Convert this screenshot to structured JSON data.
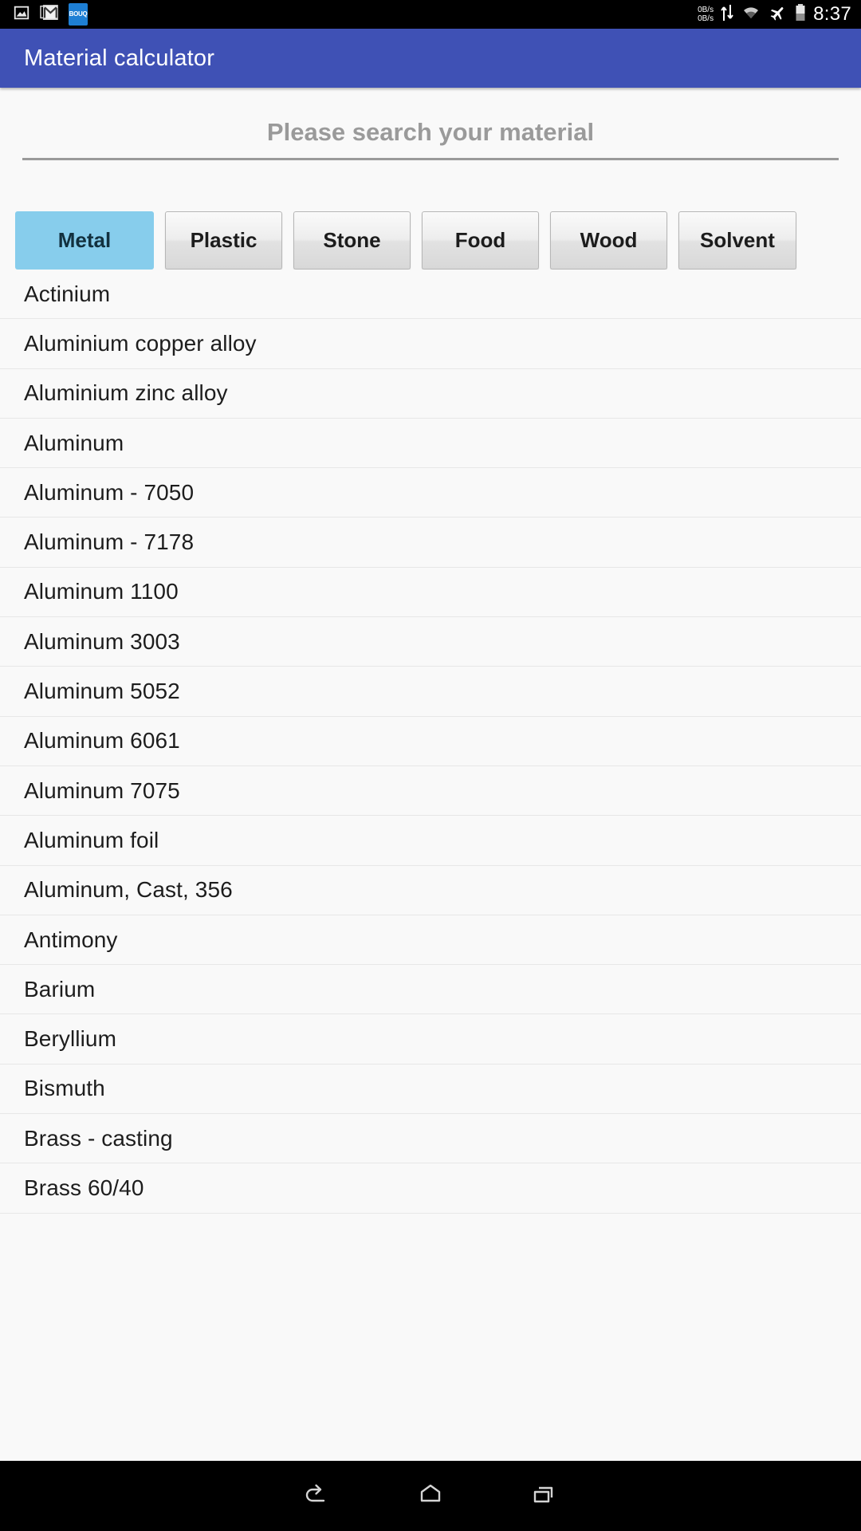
{
  "status_bar": {
    "icons_left": [
      {
        "name": "screenshot-icon",
        "label": "screenshot"
      },
      {
        "name": "gmail-icon",
        "label": "gmail"
      },
      {
        "name": "bouq-app-icon",
        "label": "BOUQ"
      }
    ],
    "app_badge_text": "BOUQ",
    "net_rate_up": "0B/s",
    "net_rate_down": "0B/s",
    "icons_right": [
      {
        "name": "data-transfer-icon",
        "label": "data transfer"
      },
      {
        "name": "wifi-icon",
        "label": "wifi"
      },
      {
        "name": "airplane-mode-icon",
        "label": "airplane mode"
      },
      {
        "name": "battery-icon",
        "label": "battery"
      }
    ],
    "clock": "8:37"
  },
  "app_bar": {
    "title": "Material calculator",
    "background_color": "#3f51b5",
    "title_color": "#ffffff"
  },
  "search": {
    "value": "",
    "placeholder": "Please search your material"
  },
  "tabs": {
    "selected_index": 0,
    "selected_color": "#87cdec",
    "items": [
      {
        "label": "Metal"
      },
      {
        "label": "Plastic"
      },
      {
        "label": "Stone"
      },
      {
        "label": "Food"
      },
      {
        "label": "Wood"
      },
      {
        "label": "Solvent"
      }
    ]
  },
  "material_list": {
    "items": [
      {
        "name": "Actinium"
      },
      {
        "name": "Aluminium copper alloy"
      },
      {
        "name": "Aluminium zinc alloy"
      },
      {
        "name": "Aluminum"
      },
      {
        "name": "Aluminum - 7050"
      },
      {
        "name": "Aluminum - 7178"
      },
      {
        "name": "Aluminum 1100"
      },
      {
        "name": "Aluminum 3003"
      },
      {
        "name": "Aluminum 5052"
      },
      {
        "name": "Aluminum 6061"
      },
      {
        "name": "Aluminum 7075"
      },
      {
        "name": "Aluminum foil"
      },
      {
        "name": "Aluminum, Cast, 356"
      },
      {
        "name": "Antimony"
      },
      {
        "name": "Barium"
      },
      {
        "name": "Beryllium"
      },
      {
        "name": "Bismuth"
      },
      {
        "name": "Brass - casting"
      },
      {
        "name": "Brass 60/40"
      }
    ]
  },
  "nav_bar": {
    "buttons": [
      {
        "name": "back-button",
        "icon": "back-arrow-icon"
      },
      {
        "name": "home-button",
        "icon": "home-icon"
      },
      {
        "name": "recents-button",
        "icon": "recents-icon"
      }
    ]
  }
}
